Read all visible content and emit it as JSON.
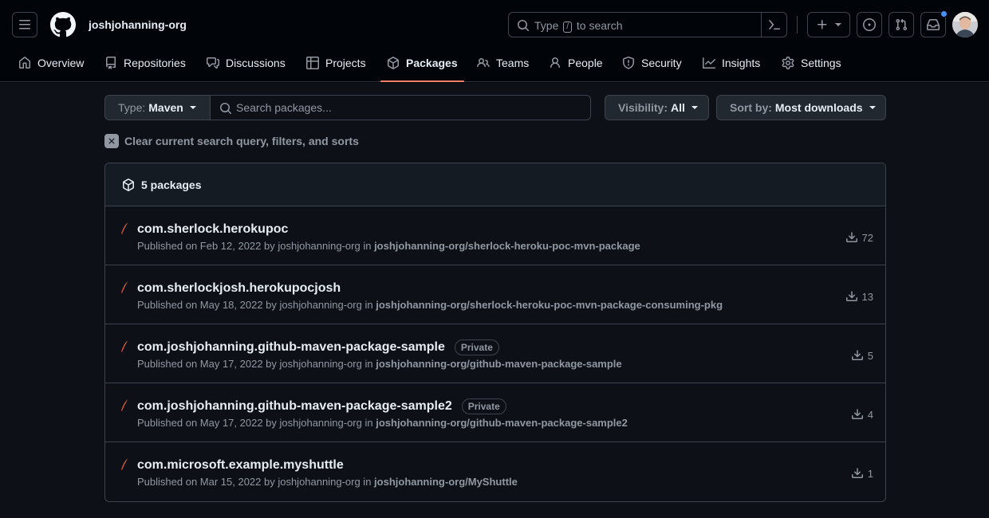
{
  "header": {
    "org_name": "joshjohanning-org",
    "search_prefix": "Type",
    "search_key": "/",
    "search_suffix": "to search"
  },
  "nav": {
    "tabs": [
      {
        "label": "Overview",
        "icon": "home-icon"
      },
      {
        "label": "Repositories",
        "icon": "repo-icon"
      },
      {
        "label": "Discussions",
        "icon": "comment-discussion-icon"
      },
      {
        "label": "Projects",
        "icon": "table-icon"
      },
      {
        "label": "Packages",
        "icon": "package-icon",
        "active": true
      },
      {
        "label": "Teams",
        "icon": "people-icon"
      },
      {
        "label": "People",
        "icon": "person-icon"
      },
      {
        "label": "Security",
        "icon": "shield-icon"
      },
      {
        "label": "Insights",
        "icon": "graph-icon"
      },
      {
        "label": "Settings",
        "icon": "gear-icon"
      }
    ]
  },
  "filters": {
    "type_label": "Type:",
    "type_value": "Maven",
    "search_placeholder": "Search packages...",
    "visibility_label": "Visibility:",
    "visibility_value": "All",
    "sort_label": "Sort by:",
    "sort_value": "Most downloads",
    "clear_text": "Clear current search query, filters, and sorts"
  },
  "packages": {
    "count_label": "5 packages",
    "items": [
      {
        "name": "com.sherlock.herokupoc",
        "badge": "",
        "published_prefix": "Published on Feb 12, 2022 by joshjohanning-org in",
        "repo": "joshjohanning-org/sherlock-heroku-poc-mvn-package",
        "downloads": "72"
      },
      {
        "name": "com.sherlockjosh.herokupocjosh",
        "badge": "",
        "published_prefix": "Published on May 18, 2022 by joshjohanning-org in",
        "repo": "joshjohanning-org/sherlock-heroku-poc-mvn-package-consuming-pkg",
        "downloads": "13"
      },
      {
        "name": "com.joshjohanning.github-maven-package-sample",
        "badge": "Private",
        "published_prefix": "Published on May 17, 2022 by joshjohanning-org in",
        "repo": "joshjohanning-org/github-maven-package-sample",
        "downloads": "5"
      },
      {
        "name": "com.joshjohanning.github-maven-package-sample2",
        "badge": "Private",
        "published_prefix": "Published on May 17, 2022 by joshjohanning-org in",
        "repo": "joshjohanning-org/github-maven-package-sample2",
        "downloads": "4"
      },
      {
        "name": "com.microsoft.example.myshuttle",
        "badge": "",
        "published_prefix": "Published on Mar 15, 2022 by joshjohanning-org in",
        "repo": "joshjohanning-org/MyShuttle",
        "downloads": "1"
      }
    ]
  },
  "colors": {
    "page_bg": "#010409",
    "main_bg": "#0d1117",
    "border": "#3d444d",
    "active_tab_underline": "#f78166",
    "notification_dot": "#4493f8",
    "maven_feather": "#e0463e"
  }
}
